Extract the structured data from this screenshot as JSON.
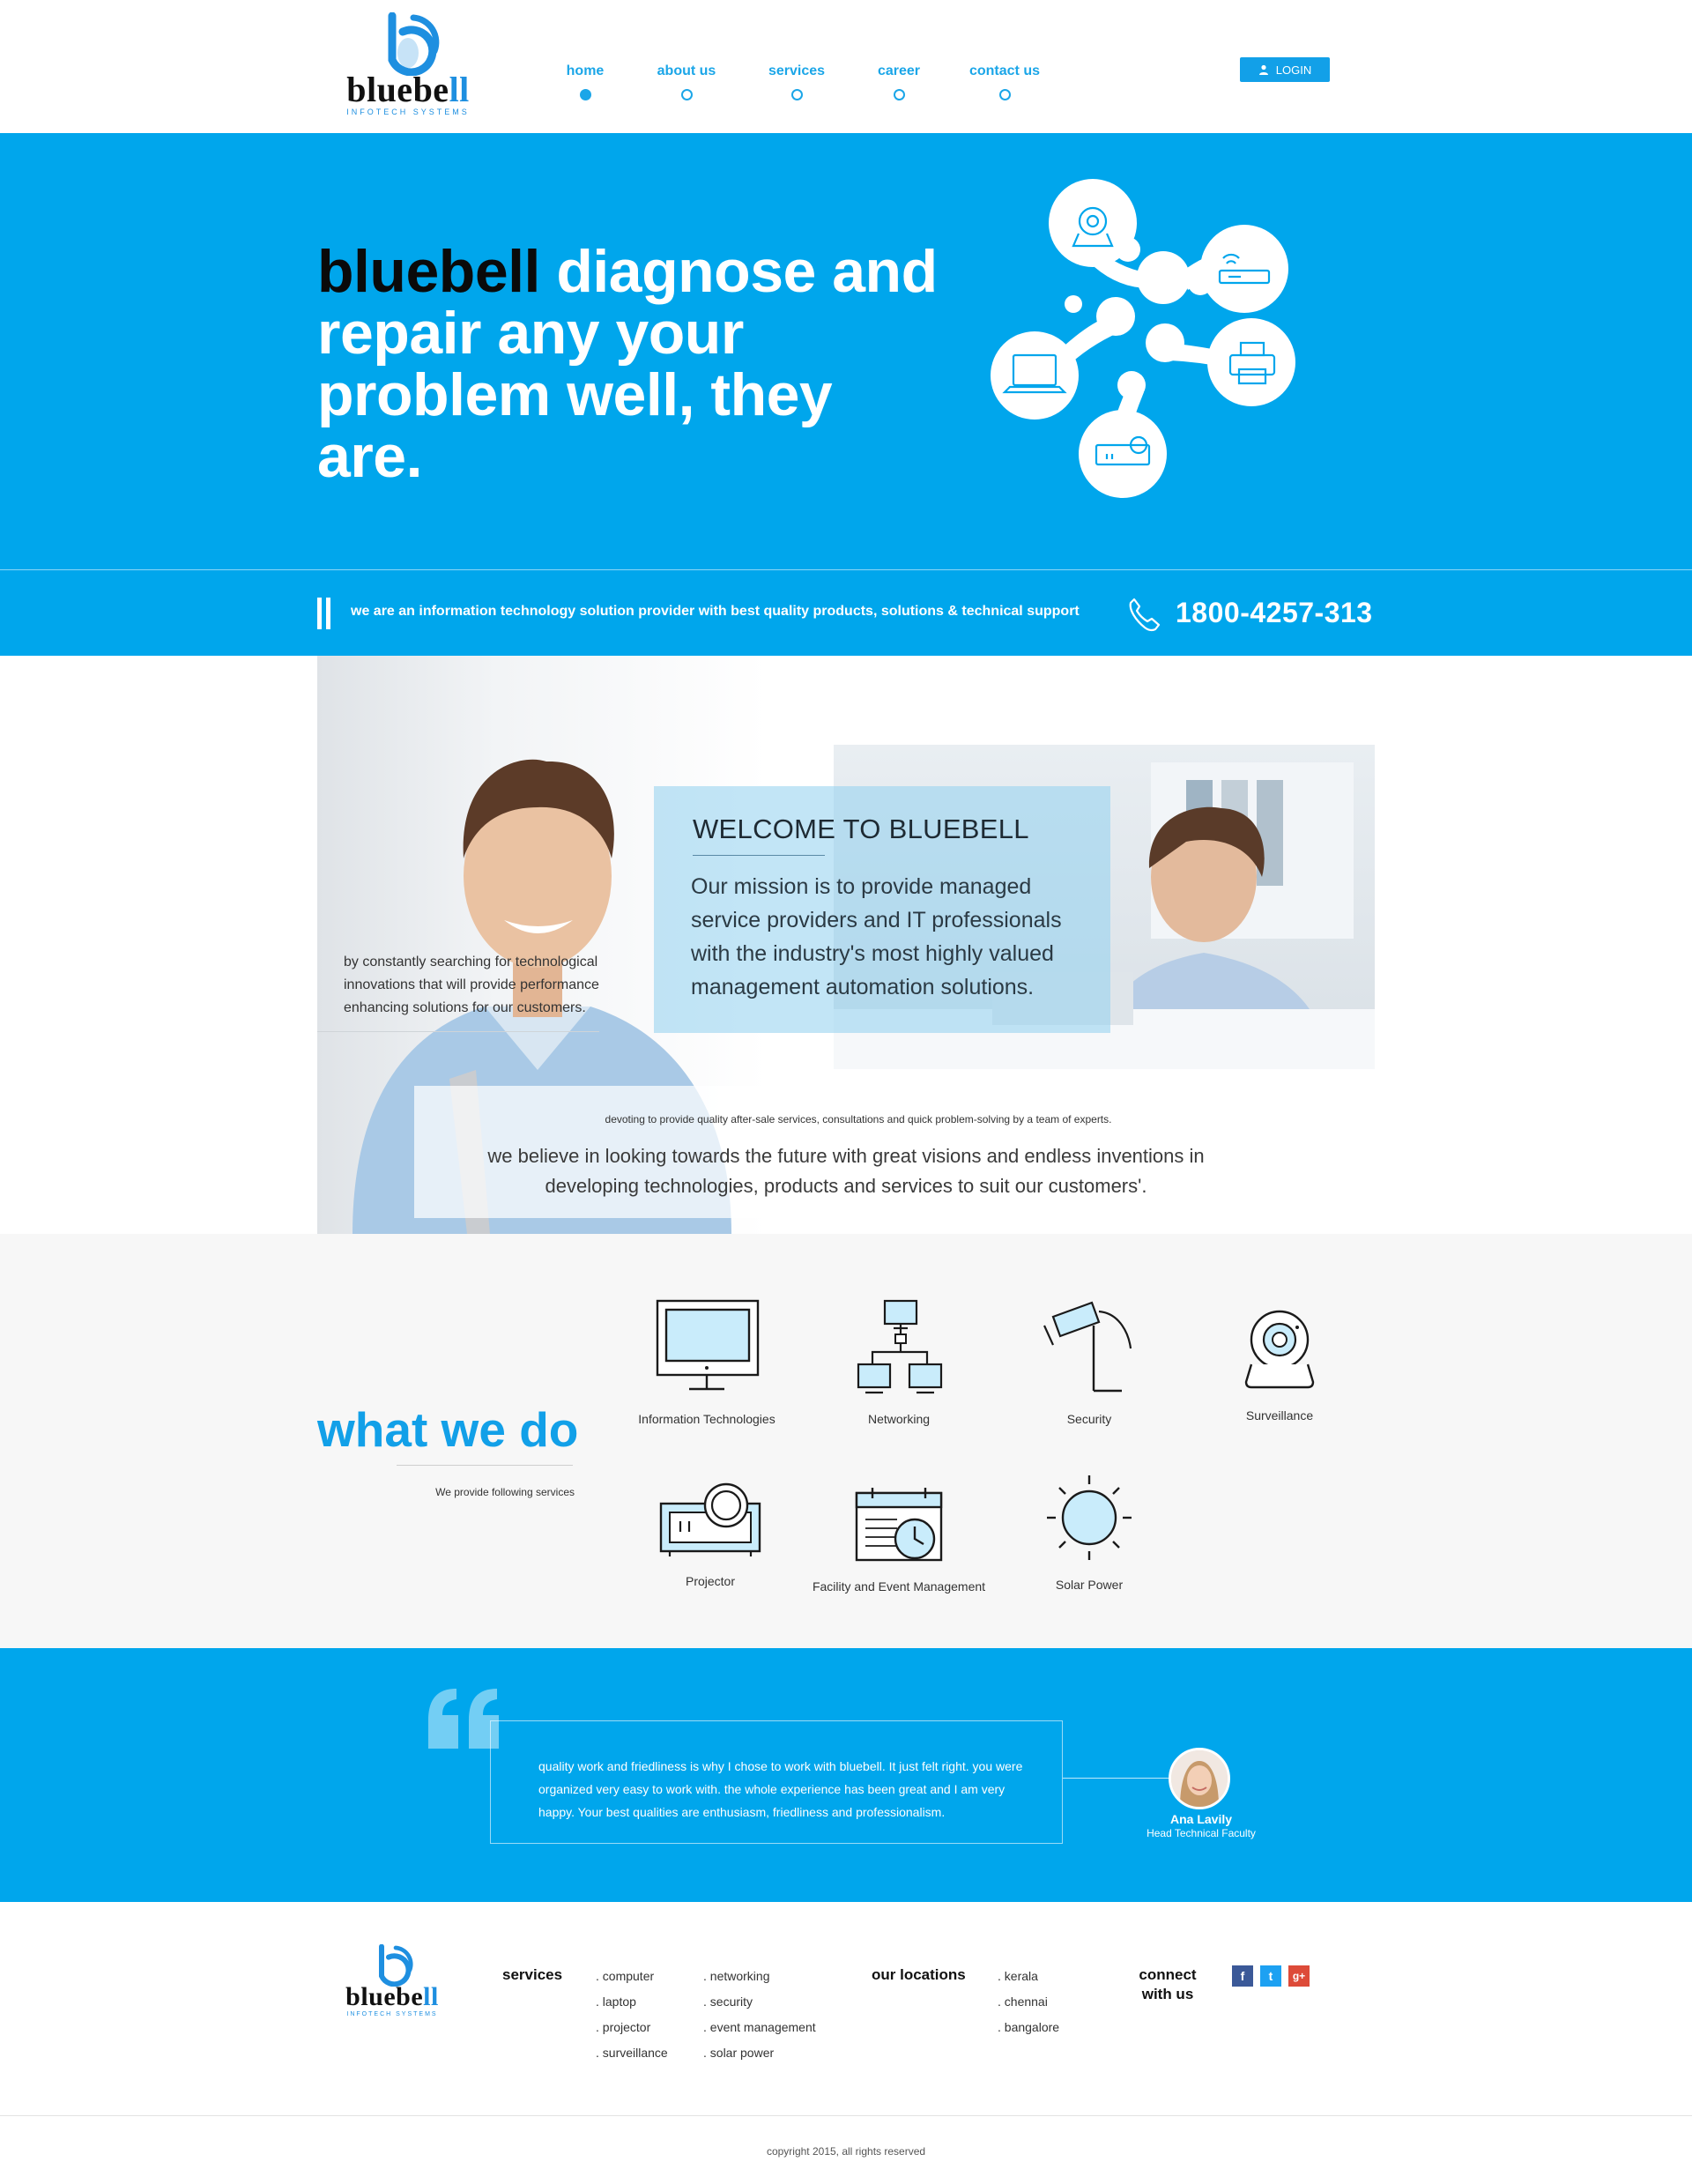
{
  "brand": {
    "name_main": "bluebe",
    "name_tail": "ll",
    "tagline": "INFOTECH SYSTEMS",
    "accent_color": "#00a6ec",
    "icon": "bluebell-b-logo"
  },
  "nav": {
    "items": [
      {
        "label": "home",
        "active": true
      },
      {
        "label": "about us",
        "active": false
      },
      {
        "label": "services",
        "active": false
      },
      {
        "label": "career",
        "active": false
      },
      {
        "label": "contact us",
        "active": false
      }
    ],
    "login_label": "LOGIN",
    "login_icon": "user-icon"
  },
  "hero": {
    "title_brand": "bluebell",
    "title_rest": " diagnose and repair any your problem well, they are.",
    "graphic_icons": [
      "webcam-icon",
      "router-icon",
      "laptop-icon",
      "printer-icon",
      "projector-icon"
    ]
  },
  "tagline_bar": {
    "text": "we are an information technology solution provider with best quality products, solutions & technical support",
    "phone_icon": "phone-icon",
    "phone": "1800-4257-313"
  },
  "welcome": {
    "title": "WELCOME TO BLUEBELL",
    "mission": "Our mission is to provide managed service providers and IT professionals with the industry's most highly valued management automation solutions.",
    "left_caption": "by constantly searching for technological innovations that will provide performance enhancing solutions for our customers.",
    "devote": "devoting to provide quality after-sale services, consultations and quick problem-solving by a team of experts.",
    "believe": "we believe in looking towards the future with great visions and endless inventions in developing technologies, products and services to suit our customers'."
  },
  "services": {
    "title": "what we do",
    "subtitle": "We provide following services",
    "items": [
      {
        "label": "Information Technologies",
        "icon": "monitor-icon"
      },
      {
        "label": "Networking",
        "icon": "network-icon"
      },
      {
        "label": "Security",
        "icon": "security-camera-icon"
      },
      {
        "label": "Surveillance",
        "icon": "webcam-icon"
      },
      {
        "label": "Projector",
        "icon": "projector-icon"
      },
      {
        "label": "Facility and Event Management",
        "icon": "calendar-clock-icon"
      },
      {
        "label": "Solar Power",
        "icon": "sun-icon"
      }
    ]
  },
  "testimonial": {
    "quote": "quality work and friedliness is why I chose to work with bluebell. It just felt right. you were organized very easy to work with.  the whole experience has been great and I am very happy. Your best qualities are enthusiasm, friedliness and professionalism.",
    "author": "Ana Lavily",
    "role": "Head Technical Faculty"
  },
  "footer": {
    "services_heading": "services",
    "services_col1": [
      ". computer",
      ". laptop",
      ". projector",
      ". surveillance"
    ],
    "services_col2": [
      ". networking",
      ". security",
      ". event management",
      ". solar power"
    ],
    "locations_heading": "our locations",
    "locations": [
      ". kerala",
      ". chennai",
      ". bangalore"
    ],
    "connect_heading_1": "connect",
    "connect_heading_2": "with us",
    "social": [
      {
        "name": "facebook",
        "glyph": "f",
        "color": "#3b5998"
      },
      {
        "name": "twitter",
        "glyph": "t",
        "color": "#1da1f2"
      },
      {
        "name": "google-plus",
        "glyph": "g+",
        "color": "#dd4b39"
      }
    ],
    "copyright": "copyright 2015, all rights reserved"
  }
}
